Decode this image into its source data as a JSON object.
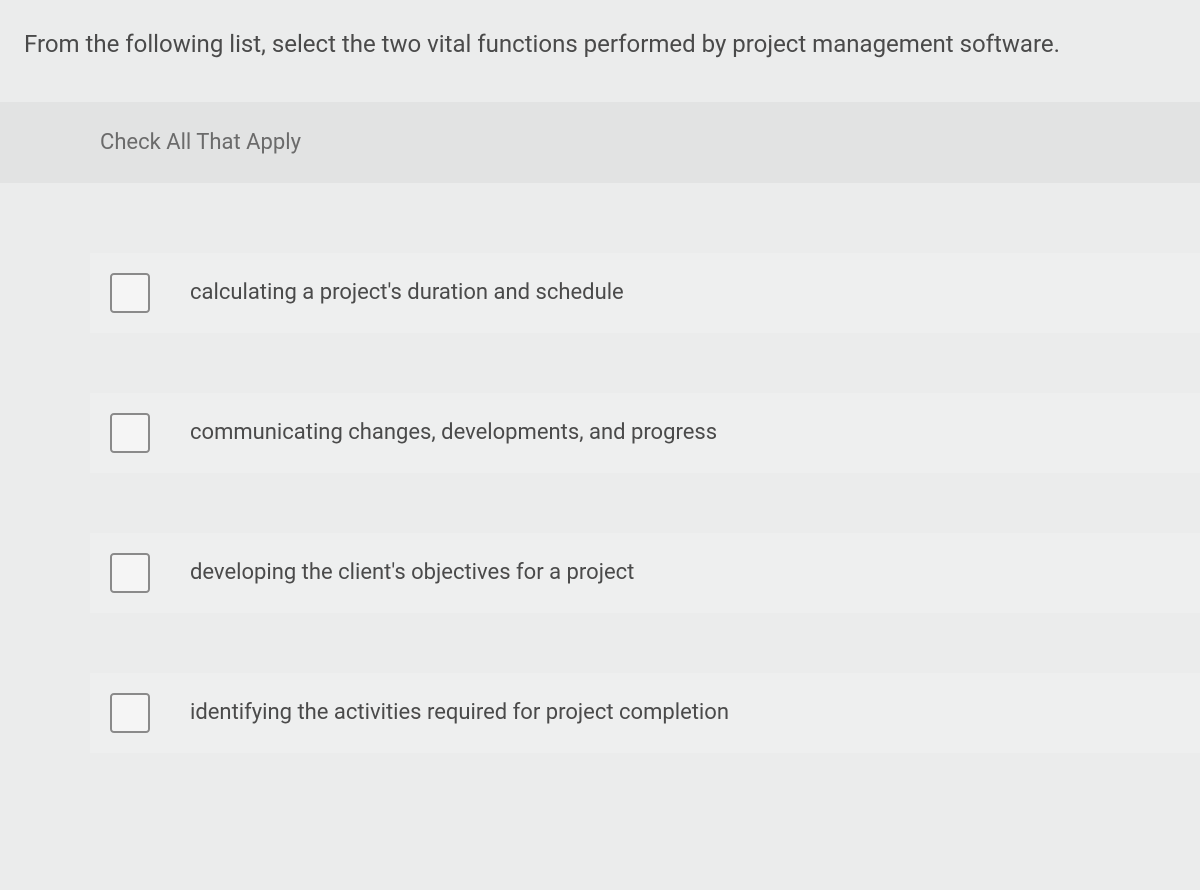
{
  "question": "From the following list, select the two vital functions performed by project management software.",
  "instruction": "Check All That Apply",
  "options": [
    {
      "label": "calculating a project's duration and schedule"
    },
    {
      "label": "communicating changes, developments, and progress"
    },
    {
      "label": "developing the client's objectives for a project"
    },
    {
      "label": "identifying the activities required for project completion"
    }
  ]
}
